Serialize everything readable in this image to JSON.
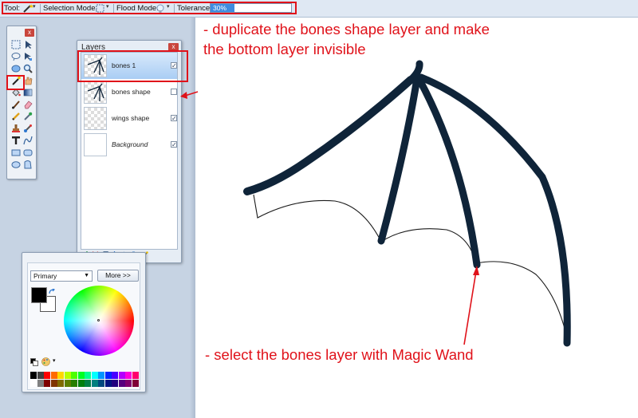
{
  "toolbar": {
    "tool_label": "Tool:",
    "selection_mode_label": "Selection Mode:",
    "flood_mode_label": "Flood Mode:",
    "tolerance_label": "Tolerance:",
    "tolerance_value": "30%",
    "tolerance_fraction": 0.3
  },
  "tools_window": {
    "close_label": "x",
    "icons": [
      "rectangle-select-icon",
      "move-selection-icon",
      "lasso-select-icon",
      "move-selected-icon",
      "ellipse-select-icon",
      "zoom-icon",
      "magic-wand-icon",
      "pan-icon",
      "paint-bucket-icon",
      "gradient-icon",
      "paintbrush-icon",
      "eraser-icon",
      "pencil-icon",
      "color-picker-icon",
      "clone-stamp-icon",
      "recolor-icon",
      "text-icon",
      "line-curve-icon",
      "rectangle-shape-icon",
      "rounded-rectangle-icon",
      "ellipse-shape-icon",
      "freeform-shape-icon"
    ]
  },
  "layers_window": {
    "title": "Layers",
    "close_label": "x",
    "items": [
      {
        "name": "bones 1",
        "visible": true,
        "selected": true,
        "italic": false
      },
      {
        "name": "bones shape",
        "visible": false,
        "selected": false,
        "italic": false
      },
      {
        "name": "wings shape",
        "visible": true,
        "selected": false,
        "italic": false
      },
      {
        "name": "Background",
        "visible": true,
        "selected": false,
        "italic": true
      }
    ],
    "footer_icons": [
      "add-layer-icon",
      "delete-layer-icon",
      "duplicate-layer-icon",
      "merge-layer-down-icon",
      "move-layer-up-icon",
      "move-layer-down-icon",
      "layer-properties-icon"
    ]
  },
  "colors_window": {
    "mode_select": "Primary",
    "more_button": "More >>",
    "primary_color": "#000000",
    "secondary_color": "#ffffff",
    "palette": [
      "#000000",
      "#404040",
      "#ff0000",
      "#ff6a00",
      "#ffd800",
      "#b6ff00",
      "#4cff00",
      "#00ff21",
      "#00ff90",
      "#00ffff",
      "#0094ff",
      "#0026ff",
      "#4800ff",
      "#b200ff",
      "#ff00dc",
      "#ff006e",
      "#ffffff",
      "#808080",
      "#7f0000",
      "#7f3300",
      "#7f6a00",
      "#5b7f00",
      "#267f00",
      "#007f0e",
      "#007f46",
      "#007f7f",
      "#004a7f",
      "#00137f",
      "#21007f",
      "#57007f",
      "#7f006e",
      "#7f0037"
    ]
  },
  "annotations": {
    "top_line1": "- duplicate the bones shape layer and make",
    "top_line2": "the bottom layer invisible",
    "bottom": "- select the bones layer with Magic Wand"
  },
  "colors": {
    "annotation_red": "#e0121a",
    "bone_navy": "#0f2439",
    "selection_blue": "#a9cdf4"
  }
}
